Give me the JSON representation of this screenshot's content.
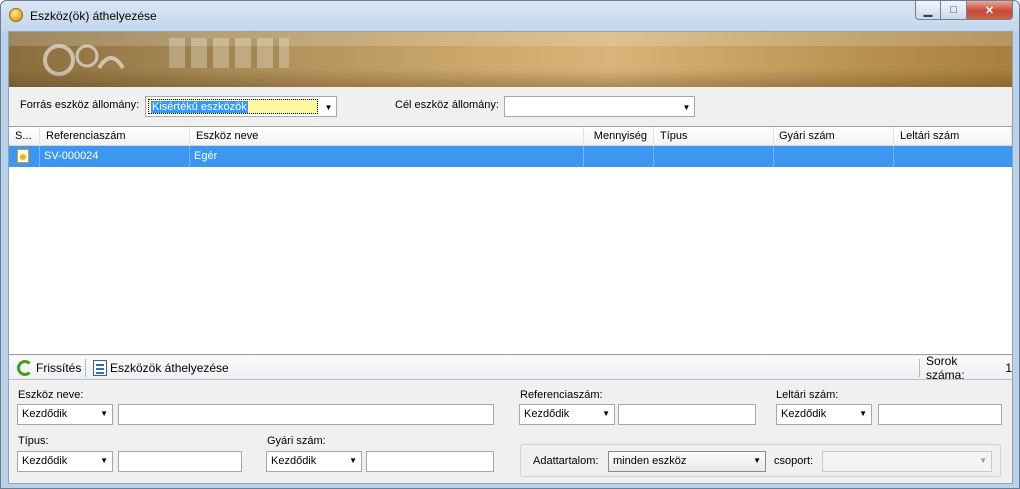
{
  "window": {
    "title": "Eszköz(ök) áthelyezése",
    "buttons": {
      "minimize": "▁",
      "maximize": "□",
      "close": "✕"
    }
  },
  "source": {
    "label": "Forrás eszköz állomány:",
    "value": "Kisértékű eszközök"
  },
  "target": {
    "label": "Cél eszköz állomány:",
    "value": ""
  },
  "grid": {
    "columns": [
      "S...",
      "Referenciaszám",
      "Eszköz neve",
      "Mennyiség",
      "Típus",
      "Gyári szám",
      "Leltári szám"
    ],
    "rows": [
      {
        "status_icon": "asset-icon",
        "ref": "SV-000024",
        "name": "Egér",
        "qty": "",
        "type": "",
        "serial": "",
        "inventory": ""
      }
    ]
  },
  "toolbar": {
    "refresh_label": "Frissítés",
    "move_label": "Eszközök áthelyezése",
    "row_count_label": "Sorok száma:",
    "row_count_value": "1"
  },
  "filters": {
    "asset_name": {
      "label": "Eszköz neve:",
      "mode": "Kezdődik",
      "value": ""
    },
    "reference": {
      "label": "Referenciaszám:",
      "mode": "Kezdődik",
      "value": ""
    },
    "inventory": {
      "label": "Leltári szám:",
      "mode": "Kezdődik",
      "value": ""
    },
    "type": {
      "label": "Típus:",
      "mode": "Kezdődik",
      "value": ""
    },
    "serial": {
      "label": "Gyári szám:",
      "mode": "Kezdődik",
      "value": ""
    },
    "content": {
      "label": "Adattartalom:",
      "value": "minden eszköz"
    },
    "group": {
      "label": "csoport:",
      "value": ""
    }
  },
  "colors": {
    "selection": "#3d96f0",
    "banner": "#c9a66a"
  }
}
